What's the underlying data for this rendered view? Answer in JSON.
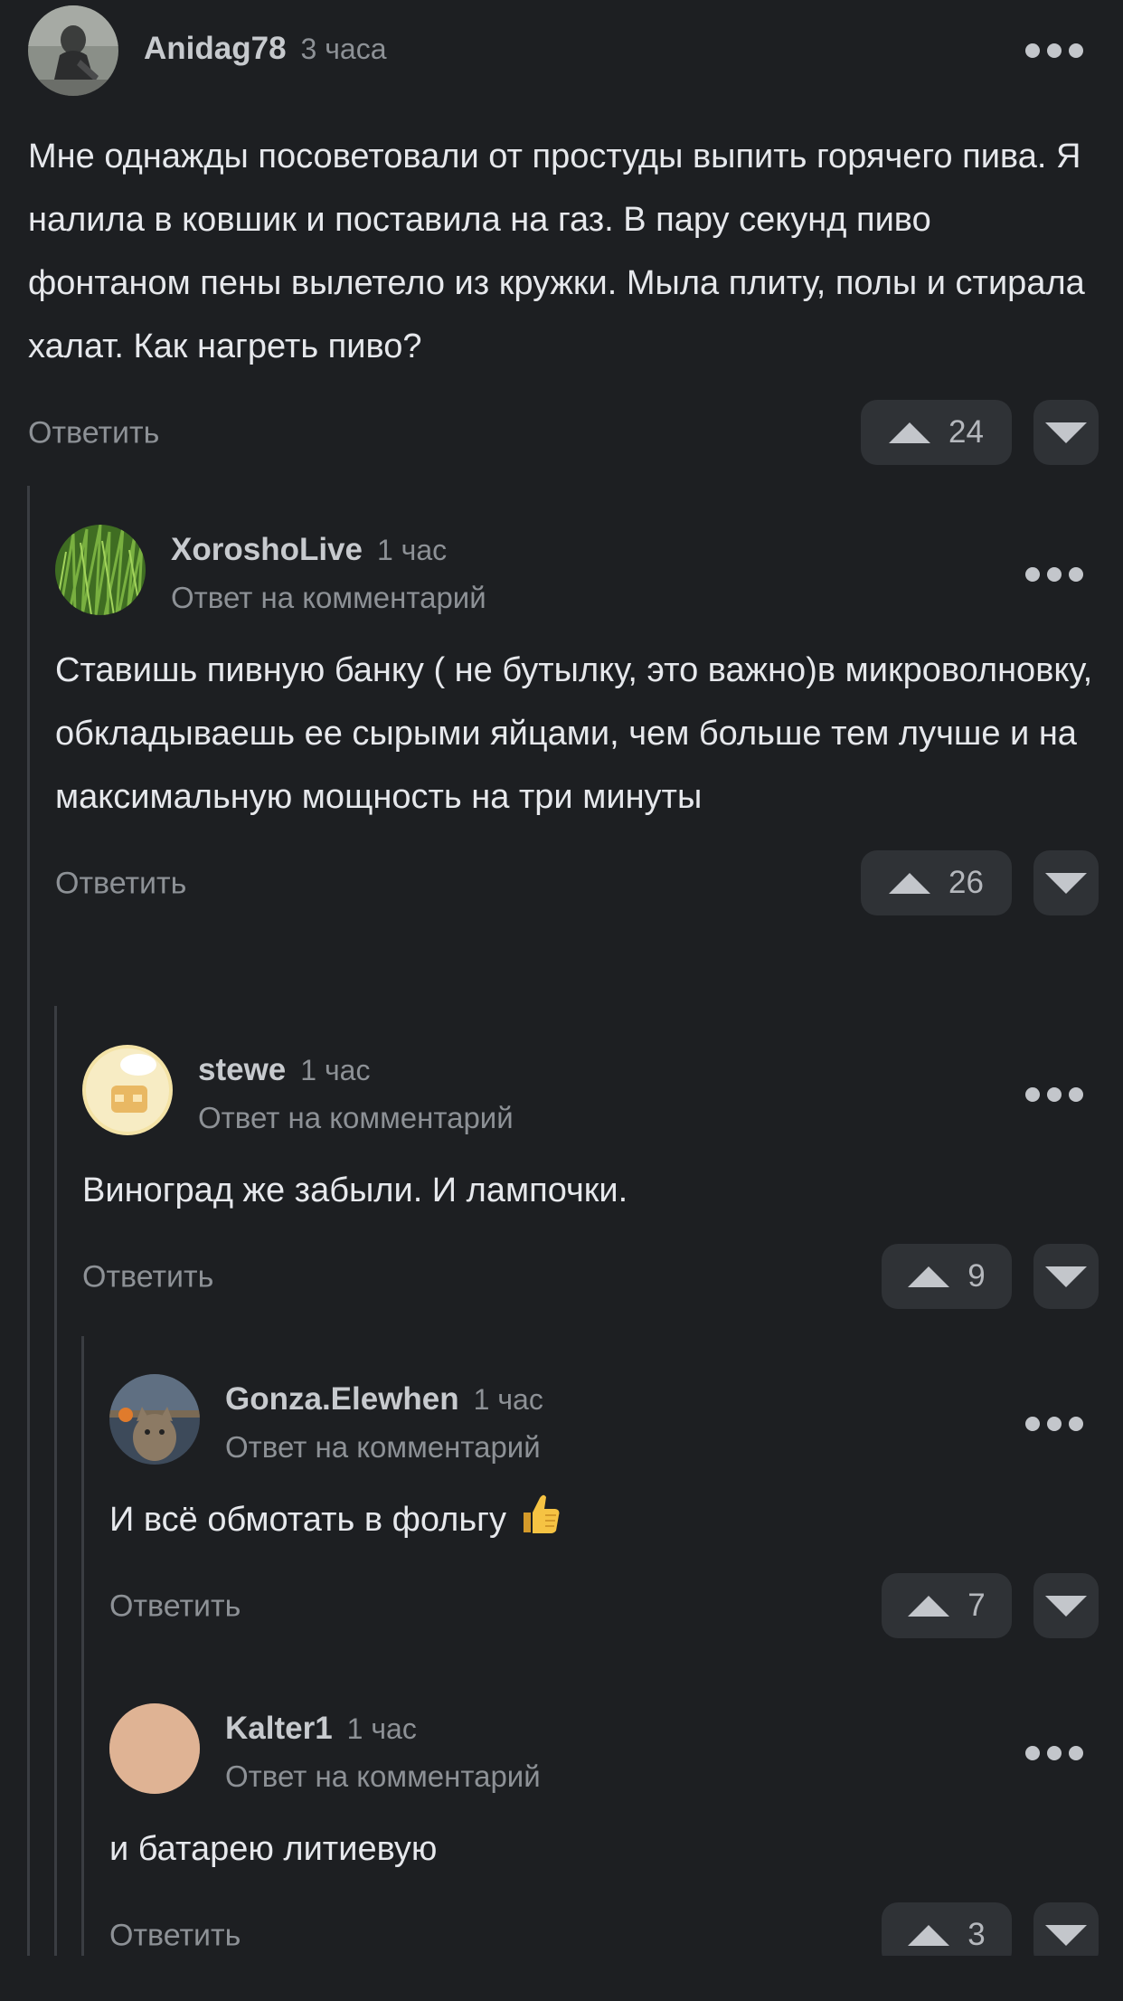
{
  "comments": [
    {
      "username": "Anidag78",
      "time": "3 часа",
      "reply_to": "",
      "text": "Мне однажды посоветовали от простуды выпить горячего пива. Я налила в ковшик и поставила на газ. В пару секунд пиво фонтаном пены вылетело из кружки. Мыла плиту, полы и стирала халат. Как нагреть пиво?",
      "reply_label": "Ответить",
      "votes": "24",
      "avatar_icon": "avatar-person-photo"
    },
    {
      "username": "XoroshoLive",
      "time": "1 час",
      "reply_to": "Ответ на комментарий",
      "text": "Ставишь пивную банку ( не бутылку, это важно)в микроволновку, обкладываешь ее сырыми яйцами, чем больше тем лучше и на максимальную мощность на три минуты",
      "reply_label": "Ответить",
      "votes": "26",
      "avatar_icon": "avatar-grass-photo"
    },
    {
      "username": "stewe",
      "time": "1 час",
      "reply_to": "Ответ на комментарий",
      "text": "Виноград же забыли. И лампочки.",
      "reply_label": "Ответить",
      "votes": "9",
      "avatar_icon": "avatar-chef-cartoon"
    },
    {
      "username": "Gonza.Elewhen",
      "time": "1 час",
      "reply_to": "Ответ на комментарий",
      "text": "И всё обмотать в фольгу",
      "text_emoji": "thumbs-up-emoji",
      "reply_label": "Ответить",
      "votes": "7",
      "avatar_icon": "avatar-cat-photo"
    },
    {
      "username": "Kalter1",
      "time": "1 час",
      "reply_to": "Ответ на комментарий",
      "text": "и батарею литиевую",
      "reply_label": "Ответить",
      "votes": "3",
      "avatar_icon": "avatar-beige-circle"
    }
  ],
  "colors": {
    "background": "#1d1f22",
    "button_bg": "#2f3236",
    "thread_line": "#3a3d42",
    "muted_text": "#8d9196"
  }
}
